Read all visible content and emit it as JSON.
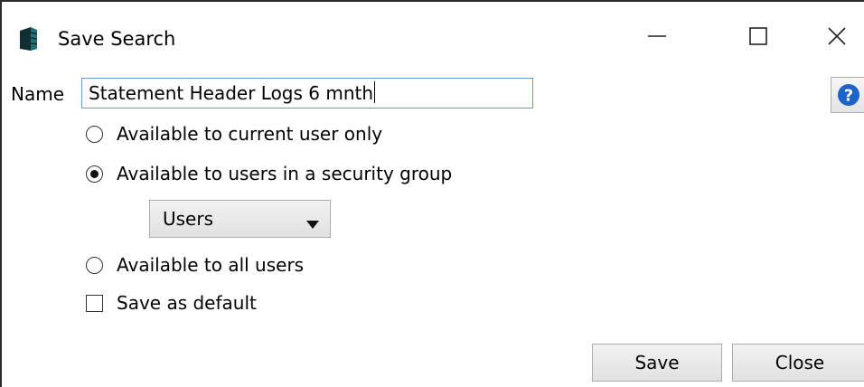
{
  "window": {
    "title": "Save Search",
    "icon": "database-icon",
    "controls": [
      "minimize-icon",
      "maximize-icon",
      "close-icon"
    ]
  },
  "form": {
    "name_label": "Name",
    "name_value": "Statement Header Logs 6 mnth",
    "help_icon": "help-icon"
  },
  "options": {
    "current_user": "Available to current user only",
    "security_group": "Available to users in a security group",
    "all_users": "Available to all users",
    "selected": "security_group",
    "save_default": "Save as default",
    "save_default_checked": false
  },
  "security_group_select": {
    "value": "Users"
  },
  "buttons": {
    "save": "Save",
    "close": "Close"
  },
  "colors": {
    "input_border": "#6b9bd3",
    "help_icon": "#1e64c8",
    "icon_teal": "#1f6f73"
  }
}
